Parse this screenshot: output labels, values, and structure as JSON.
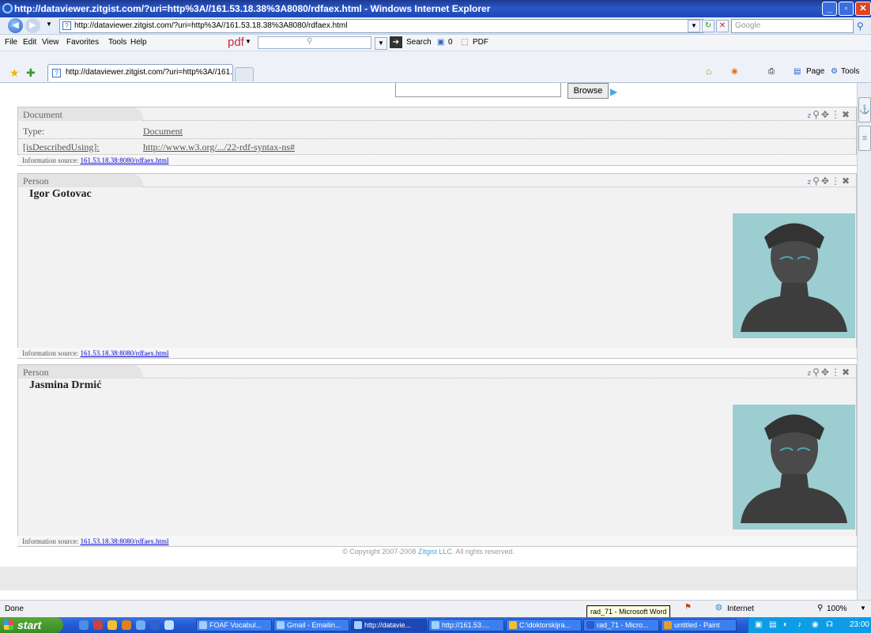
{
  "window": {
    "title": "http://dataviewer.zitgist.com/?uri=http%3A//161.53.18.38%3A8080/rdfaex.html - Windows Internet Explorer"
  },
  "address": {
    "url": "http://dataviewer.zitgist.com/?uri=http%3A//161.53.18.38%3A8080/rdfaex.html",
    "search_placeholder": "Google"
  },
  "menu": {
    "items": [
      "File",
      "Edit",
      "View",
      "Favorites",
      "Tools",
      "Help"
    ],
    "pdf_brand": "pdf",
    "search_label": "Search",
    "count": "0",
    "pdf_label": "PDF"
  },
  "tab": {
    "label": "http://dataviewer.zitgist.com/?uri=http%3A//161.53..."
  },
  "toolbar_right": {
    "page": "Page",
    "tools": "Tools"
  },
  "page": {
    "browse_label": "Browse",
    "panel_document": {
      "title": "Document",
      "rows": [
        {
          "key": "Type:",
          "value": "Document"
        },
        {
          "key": "[isDescribedUsing]:",
          "value": "http://www.w3.org/.../22-rdf-syntax-ns#"
        }
      ],
      "source_label": "Information source:",
      "source_link": "161.53.18.38:8080/rdfaex.html"
    },
    "panel_person1": {
      "title": "Person",
      "name": "Igor Gotovac",
      "source_label": "Information source:",
      "source_link": "161.53.18.38:8080/rdfaex.html"
    },
    "panel_person2": {
      "title": "Person",
      "name": "Jasmina Drmić",
      "source_label": "Information source:",
      "source_link": "161.53.18.38:8080/rdfaex.html"
    },
    "copyright_prefix": "© Copyright 2007-2008",
    "copyright_brand": "Zitgist LLC",
    "copyright_suffix": ". All rights reserved."
  },
  "status": {
    "text": "Done",
    "zone": "Internet",
    "zoom": "100%",
    "tooltip": "rad_71 - Microsoft Word"
  },
  "taskbar": {
    "start": "start",
    "tasks": [
      "FOAF Vocabul...",
      "Gmail - Emailin...",
      "http://datavie...",
      "http://161.53....",
      "C:\\doktorskijra...",
      "rad_71 - Micro...",
      "untitled - Paint"
    ],
    "time": "23:00"
  }
}
